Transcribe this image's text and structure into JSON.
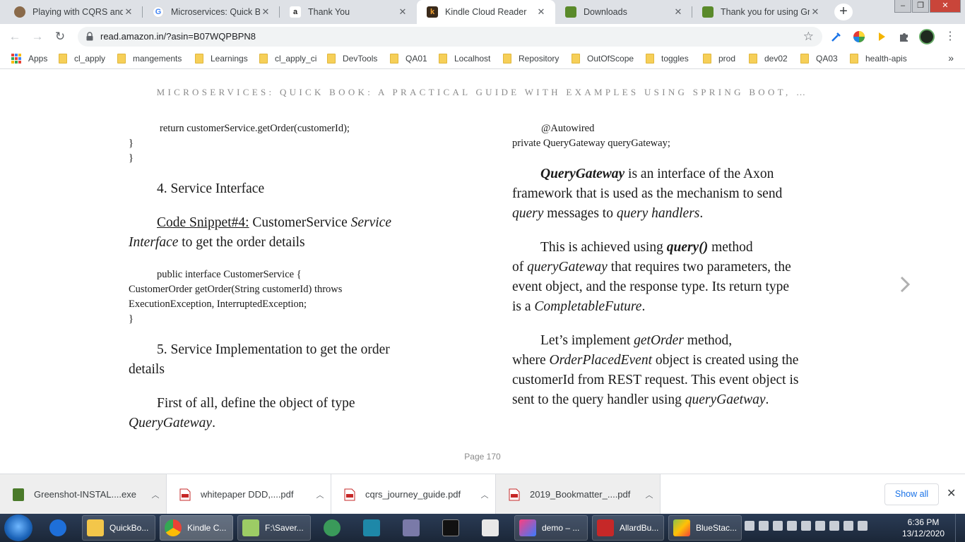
{
  "tabs": [
    {
      "title": "Playing with CQRS and E",
      "favicon": "avatar-icon",
      "color": "#8a6a4a"
    },
    {
      "title": "Microservices: Quick Boo",
      "favicon": "google-icon",
      "color": "#4285f4"
    },
    {
      "title": "Thank You",
      "favicon": "amazon-icon",
      "color": "#222222"
    },
    {
      "title": "Kindle Cloud Reader",
      "favicon": "kindle-icon",
      "color": "#f0a030"
    },
    {
      "title": "Downloads",
      "favicon": "greenshot-icon",
      "color": "#5a8a2a"
    },
    {
      "title": "Thank you for using Gree",
      "favicon": "greenshot-icon",
      "color": "#5a8a2a"
    }
  ],
  "address": {
    "url": "read.amazon.in/?asin=B07WQPBPN8"
  },
  "bookmarks": [
    "Apps",
    "cl_apply",
    "mangements",
    "Learnings",
    "cl_apply_ci",
    "DevTools",
    "QA01",
    "Localhost",
    "Repository",
    "OutOfScope",
    "toggles",
    "prod",
    "dev02",
    "QA03",
    "health-apis"
  ],
  "book": {
    "title": "MICROSERVICES: QUICK BOOK: A PRACTICAL GUIDE WITH EXAMPLES USING SPRING BOOT, …",
    "page": "Page 170",
    "left": {
      "code1_l1": "return customerService.getOrder(customerId);",
      "code1_l2": "}",
      "code1_l3": "}",
      "heading4": "4. Service Interface",
      "snippet_label": "Code Snippet#4:",
      "snippet_plain": " CustomerService ",
      "snippet_italic1": "Service",
      "snippet_italic2": "Interface",
      "snippet_rest": " to get the order details",
      "code2_l1": "public interface CustomerService {",
      "code2_l2": "CustomerOrder getOrder(String customerId) throws",
      "code2_l3": "ExecutionException, InterruptedException;",
      "code2_l4": "}",
      "heading5_l1": "5. Service Implementation to get the order",
      "heading5_l2": "details",
      "para_l1": "First of all, define the object of type",
      "para_italic": "QueryGateway",
      "para_end": "."
    },
    "right": {
      "code_l1": "@Autowired",
      "code_l2": "private QueryGateway queryGateway;",
      "p1_bold": "QueryGateway",
      "p1_a": " is an interface of the Axon",
      "p1_l2": "framework that is used as the mechanism to send",
      "p1_i1": "query",
      "p1_b": " messages to ",
      "p1_i2": "query handlers",
      "p1_c": ".",
      "p2_a": "This is achieved using ",
      "p2_bold": "query()",
      "p2_b": " method",
      "p2_c": "of ",
      "p2_i1": "queryGateway",
      "p2_d": " that requires two parameters, the",
      "p2_l3": "event object, and the response type. Its return type",
      "p2_e": "is a ",
      "p2_i2": "CompletableFuture",
      "p2_f": ".",
      "p3_a": "Let’s implement ",
      "p3_i1": "getOrder",
      "p3_b": " method,",
      "p3_c": "where ",
      "p3_i2": "OrderPlacedEvent",
      "p3_d": " object is created using the",
      "p3_l3": "customerId from REST request. This event object is",
      "p3_e": "sent to the query handler using ",
      "p3_i3": "queryGaetway",
      "p3_f": "."
    }
  },
  "downloads": {
    "items": [
      {
        "name": "Greenshot-INSTAL....exe",
        "icon": "greenshot-icon"
      },
      {
        "name": "whitepaper DDD,....pdf",
        "icon": "pdf-icon"
      },
      {
        "name": "cqrs_journey_guide.pdf",
        "icon": "pdf-icon"
      },
      {
        "name": "2019_Bookmatter_....pdf",
        "icon": "pdf-icon"
      }
    ],
    "show_all": "Show all"
  },
  "taskbar": {
    "items": [
      {
        "label": "QuickBo..."
      },
      {
        "label": "Kindle C..."
      },
      {
        "label": "F:\\Saver..."
      },
      {
        "label": "demo – ..."
      },
      {
        "label": "AllardBu..."
      },
      {
        "label": "BlueStac..."
      }
    ],
    "time": "6:36 PM",
    "date": "13/12/2020"
  }
}
